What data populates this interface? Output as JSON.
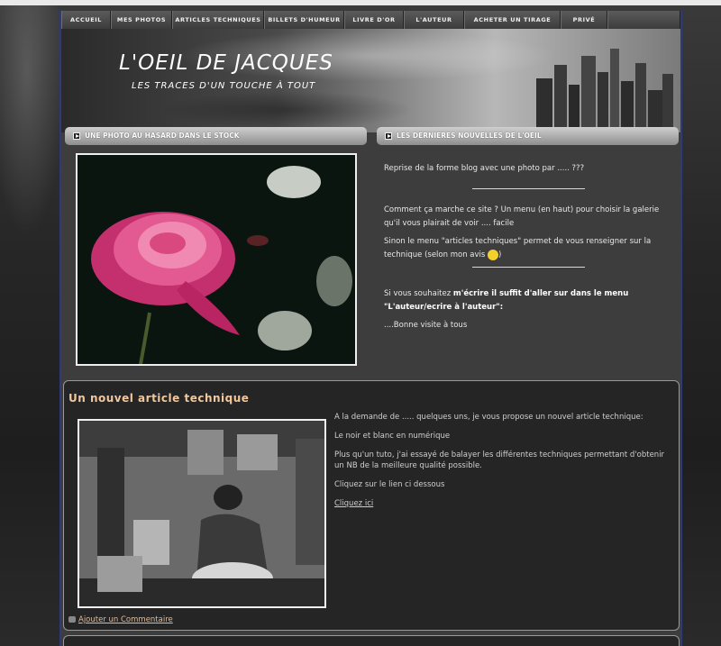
{
  "nav": {
    "items": [
      {
        "label": "ACCUEIL"
      },
      {
        "label": "MES PHOTOS"
      },
      {
        "label": "ARTICLES TECHNIQUES"
      },
      {
        "label": "BILLETS D'HUMEUR"
      },
      {
        "label": "LIVRE D'OR"
      },
      {
        "label": "L'AUTEUR"
      },
      {
        "label": "ACHETER UN TIRAGE"
      },
      {
        "label": "PRIVÉ"
      }
    ]
  },
  "header": {
    "title": "L'OEIL DE JACQUES",
    "subtitle": "LES TRACES D'UN TOUCHE À TOUT"
  },
  "photo_section": {
    "heading": "UNE PHOTO AU HASARD DANS LE STOCK"
  },
  "news_section": {
    "heading": "LES DERNIERES NOUVELLES DE L'OEIL",
    "p1": "Reprise de la forme blog avec une photo par ..... ???",
    "p2": "Comment ça marche ce site  ?  Un menu (en haut) pour choisir la galerie qu'il vous plairait de voir .... facile",
    "p3_before": "Sinon le menu \"articles techniques\" permet de vous renseigner sur la technique (selon mon avis",
    "p3_after": ")",
    "p4_a": "Si vous souhaitez ",
    "p4_b": "m'écrire il suffit d'aller sur dans le menu \"L'auteur/ecrire à l'auteur\":",
    "p5": "....Bonne visite à tous"
  },
  "article": {
    "title": "Un nouvel article technique",
    "p1": "A la demande de ..... quelques uns, je vous propose un nouvel article technique:",
    "p2": "Le noir et blanc en numérique",
    "p3": "Plus qu'un tuto, j'ai essayé de balayer les différentes techniques permettant d'obtenir un NB de la meilleure qualité possible.",
    "p4": "Cliquez sur le lien ci dessous",
    "link": "Cliquez ici",
    "comment": "Ajouter un Commentaire"
  }
}
